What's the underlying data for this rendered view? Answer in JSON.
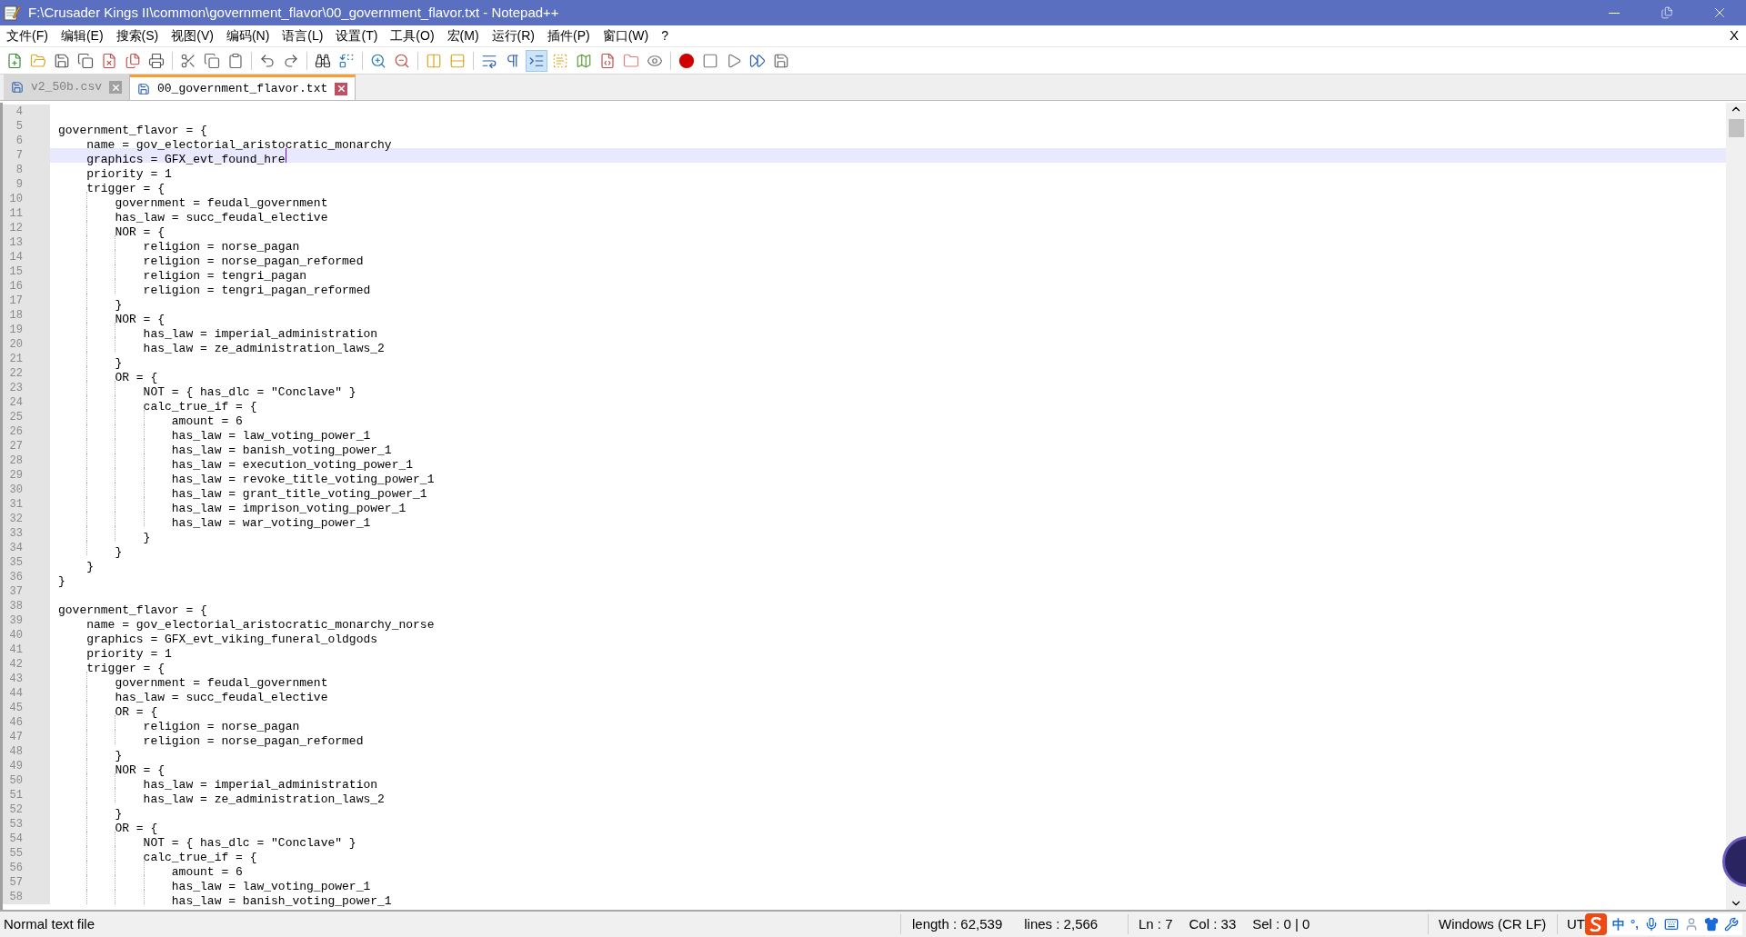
{
  "window": {
    "title": "F:\\Crusader Kings II\\common\\government_flavor\\00_government_flavor.txt - Notepad++"
  },
  "menu": [
    "文件(F)",
    "编辑(E)",
    "搜索(S)",
    "视图(V)",
    "编码(N)",
    "语言(L)",
    "设置(T)",
    "工具(O)",
    "宏(M)",
    "运行(R)",
    "插件(P)",
    "窗口(W)",
    "?"
  ],
  "menu_close": "X",
  "tabs": [
    {
      "label": "v2_50b.csv",
      "selected": false
    },
    {
      "label": "00_government_flavor.txt",
      "selected": true
    }
  ],
  "editor": {
    "lines": [
      {
        "number": "4",
        "current": false
      },
      {
        "number": "5",
        "text": "government_flavor = {",
        "current": false
      },
      {
        "number": "6",
        "text": "    name = gov_electorial_aristocratic_monarchy",
        "current": false
      },
      {
        "number": "7",
        "text": "    graphics = GFX_evt_found_hre",
        "current": true
      },
      {
        "number": "8",
        "text": "    priority = 1",
        "current": false
      },
      {
        "number": "9",
        "text": "    trigger = {",
        "current": false
      },
      {
        "number": "10",
        "text": "        government = feudal_government",
        "current": false
      },
      {
        "number": "11",
        "text": "        has_law = succ_feudal_elective",
        "current": false
      },
      {
        "number": "12",
        "text": "        NOR = {",
        "current": false
      },
      {
        "number": "13",
        "text": "            religion = norse_pagan",
        "current": false
      },
      {
        "number": "14",
        "text": "            religion = norse_pagan_reformed",
        "current": false
      },
      {
        "number": "15",
        "text": "            religion = tengri_pagan",
        "current": false
      },
      {
        "number": "16",
        "text": "            religion = tengri_pagan_reformed",
        "current": false
      },
      {
        "number": "17",
        "text": "        }",
        "current": false
      },
      {
        "number": "18",
        "text": "        NOR = {",
        "current": false
      },
      {
        "number": "19",
        "text": "            has_law = imperial_administration",
        "current": false
      },
      {
        "number": "20",
        "text": "            has_law = ze_administration_laws_2",
        "current": false
      },
      {
        "number": "21",
        "text": "        }",
        "current": false
      },
      {
        "number": "22",
        "text": "        OR = {",
        "current": false
      },
      {
        "number": "23",
        "text": "            NOT = { has_dlc = \"Conclave\" }",
        "current": false
      },
      {
        "number": "24",
        "text": "            calc_true_if = {",
        "current": false
      },
      {
        "number": "25",
        "text": "                amount = 6",
        "current": false
      },
      {
        "number": "26",
        "text": "                has_law = law_voting_power_1",
        "current": false
      },
      {
        "number": "27",
        "text": "                has_law = banish_voting_power_1",
        "current": false
      },
      {
        "number": "28",
        "text": "                has_law = execution_voting_power_1",
        "current": false
      },
      {
        "number": "29",
        "text": "                has_law = revoke_title_voting_power_1",
        "current": false
      },
      {
        "number": "30",
        "text": "                has_law = grant_title_voting_power_1",
        "current": false
      },
      {
        "number": "31",
        "text": "                has_law = imprison_voting_power_1",
        "current": false
      },
      {
        "number": "32",
        "text": "                has_law = war_voting_power_1",
        "current": false
      },
      {
        "number": "33",
        "text": "            }",
        "current": false
      },
      {
        "number": "34",
        "text": "        }",
        "current": false
      },
      {
        "number": "35",
        "text": "    }",
        "current": false
      },
      {
        "number": "36",
        "text": "}",
        "current": false
      },
      {
        "number": "37",
        "current": false
      },
      {
        "number": "38",
        "text": "government_flavor = {",
        "current": false
      },
      {
        "number": "39",
        "text": "    name = gov_electorial_aristocratic_monarchy_norse",
        "current": false
      },
      {
        "number": "40",
        "text": "    graphics = GFX_evt_viking_funeral_oldgods",
        "current": false
      },
      {
        "number": "41",
        "text": "    priority = 1",
        "current": false
      },
      {
        "number": "42",
        "text": "    trigger = {",
        "current": false
      },
      {
        "number": "43",
        "text": "        government = feudal_government",
        "current": false
      },
      {
        "number": "44",
        "text": "        has_law = succ_feudal_elective",
        "current": false
      },
      {
        "number": "45",
        "text": "        OR = {",
        "current": false
      },
      {
        "number": "46",
        "text": "            religion = norse_pagan",
        "current": false
      },
      {
        "number": "47",
        "text": "            religion = norse_pagan_reformed",
        "current": false
      },
      {
        "number": "48",
        "text": "        }",
        "current": false
      },
      {
        "number": "49",
        "text": "        NOR = {",
        "current": false
      },
      {
        "number": "50",
        "text": "            has_law = imperial_administration",
        "current": false
      },
      {
        "number": "51",
        "text": "            has_law = ze_administration_laws_2",
        "current": false
      },
      {
        "number": "52",
        "text": "        }",
        "current": false
      },
      {
        "number": "53",
        "text": "        OR = {",
        "current": false
      },
      {
        "number": "54",
        "text": "            NOT = { has_dlc = \"Conclave\" }",
        "current": false
      },
      {
        "number": "55",
        "text": "            calc_true_if = {",
        "current": false
      },
      {
        "number": "56",
        "text": "                amount = 6",
        "current": false
      },
      {
        "number": "57",
        "text": "                has_law = law_voting_power_1",
        "current": false
      },
      {
        "number": "58",
        "text": "                has_law = banish_voting_power_1",
        "current": false
      }
    ]
  },
  "status_bar": {
    "file_type": "Normal text file",
    "length": "length : 62,539",
    "lines": "lines : 2,566",
    "ln": "Ln : 7",
    "col": "Col : 33",
    "sel": "Sel : 0 | 0",
    "eol": "Windows (CR LF)",
    "encoding": "UT"
  },
  "ime": {
    "mode": "中",
    "punct": "°,"
  }
}
